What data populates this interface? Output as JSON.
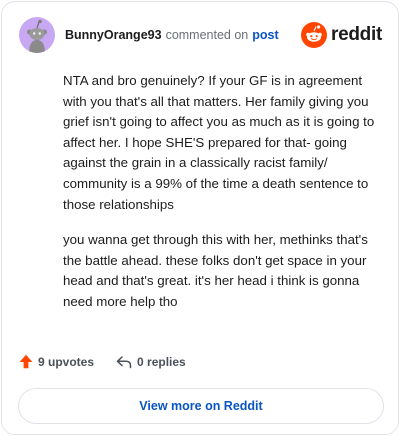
{
  "comment": {
    "username": "BunnyOrange93",
    "action": "commented on",
    "post_link": "post",
    "paragraphs": [
      "NTA and bro genuinely? If your GF is in agreement with you that's all that matters. Her family giving you grief isn't going to affect you as much as it is going to affect her. I hope SHE'S prepared for that- going against the grain in a classically racist family/ community is a 99% of the time a death sentence to those relationships",
      "you wanna get through this with her, methinks that's the battle ahead. these folks don't get space in your head and that's great. it's her head i think is gonna need more help tho"
    ],
    "upvotes_label": "9 upvotes",
    "replies_label": "0 replies"
  },
  "brand": {
    "wordmark": "reddit",
    "icon": "reddit-logo-icon",
    "color": "#ff4500"
  },
  "actions": {
    "view_more_label": "View more on Reddit"
  },
  "colors": {
    "avatar_bg": "#c9a8f3",
    "link": "#0a55c4",
    "upvote": "#ff4500",
    "muted": "#6a7075"
  }
}
